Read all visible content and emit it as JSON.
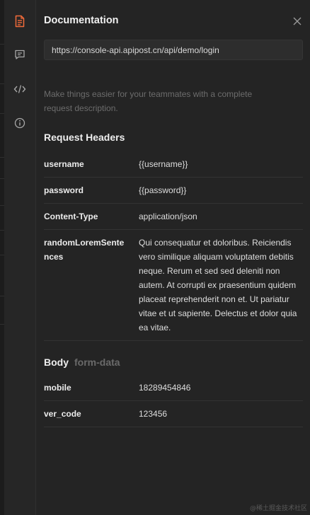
{
  "panel": {
    "title": "Documentation",
    "url": "https://console-api.apipost.cn/api/demo/login",
    "description": "Make things easier for your teammates with a complete request description."
  },
  "rail": {
    "icons": [
      "document-icon",
      "comment-icon",
      "code-icon",
      "info-icon"
    ]
  },
  "headers": {
    "title": "Request Headers",
    "rows": [
      {
        "key": "username",
        "value": "{{username}}"
      },
      {
        "key": "password",
        "value": "{{password}}"
      },
      {
        "key": "Content-Type",
        "value": "application/json"
      },
      {
        "key": "randomLoremSentences",
        "value": "Qui consequatur et doloribus. Reiciendis vero similique aliquam voluptatem debitis neque. Rerum et sed sed deleniti non autem. At corrupti ex praesentium quidem placeat reprehenderit non et. Ut pariatur vitae et ut sapiente. Delectus et dolor quia ea vitae."
      }
    ]
  },
  "body": {
    "title": "Body",
    "type": "form-data",
    "rows": [
      {
        "key": "mobile",
        "value": "18289454846"
      },
      {
        "key": "ver_code",
        "value": "123456"
      }
    ]
  },
  "watermark": "@稀土掘金技术社区",
  "colors": {
    "accent": "#f26b3a",
    "icon_gray": "#a8a8a8",
    "background": "#242424"
  }
}
